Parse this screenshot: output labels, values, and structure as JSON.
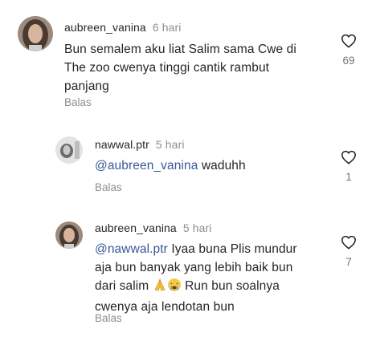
{
  "comments": [
    {
      "username": "aubreen_vanina",
      "time": "6 hari",
      "lines": [
        "Bun semalem aku liat Salim sama Cwe di",
        "The zoo cwenya tinggi cantik rambut",
        "panjang"
      ],
      "reply_label": "Balas",
      "likes": "69"
    },
    {
      "username": "nawwal.ptr",
      "time": "5 hari",
      "mention": "@aubreen_vanina",
      "text": " waduhh",
      "reply_label": "Balas",
      "likes": "1"
    },
    {
      "username": "aubreen_vanina",
      "time": "5 hari",
      "mention": "@nawwal.ptr",
      "line1_rest": " Iyaa buna Plis mundur",
      "line2": "aja bun banyak yang lebih baik bun",
      "line3a": "dari salim ",
      "line3b": " Run bun soalnya",
      "line4": "cwenya aja lendotan bun",
      "reply_label": "Balas",
      "likes": "7"
    }
  ],
  "icons": {
    "like": "heart-outline-icon",
    "emoji1": "folded-hands-emoji",
    "emoji2": "crying-face-emoji"
  },
  "colors": {
    "mention": "#385898",
    "meta": "#8e8e8e",
    "text": "#262626"
  }
}
